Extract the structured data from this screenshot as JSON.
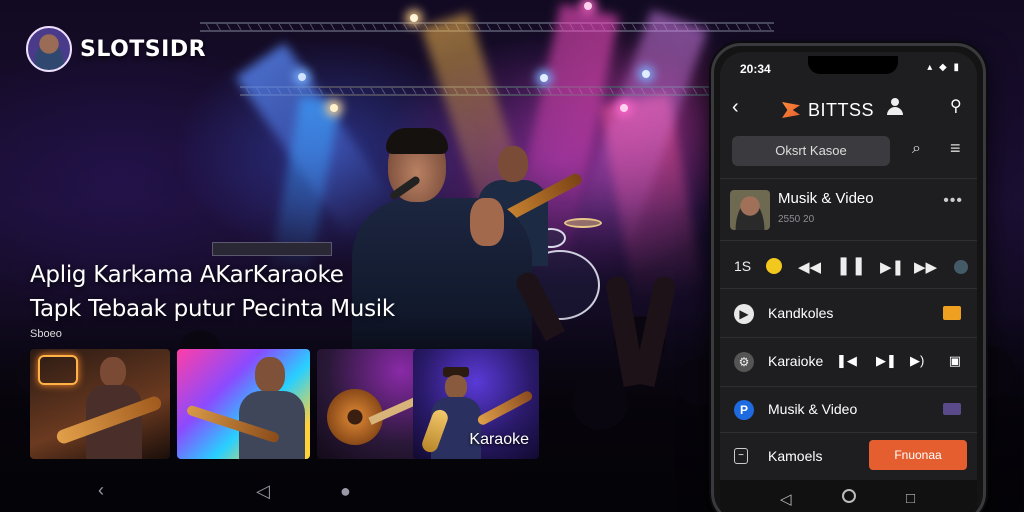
{
  "brand": {
    "name": "SLOTSIDR"
  },
  "headline": {
    "line1": "Aplig Karkama AKarKaraoke",
    "line2": "Tapk Tebaak putur Pecinta Musik",
    "tagline": "Sboeo"
  },
  "thumbnails": [
    {
      "label": ""
    },
    {
      "label": ""
    },
    {
      "label": ""
    },
    {
      "label": "Karaoke"
    }
  ],
  "phone": {
    "time": "20:34",
    "app_title": "BITTSS",
    "search_placeholder": "Oksrt Kasoe",
    "now_playing": {
      "title": "Musik & Video",
      "subtitle": "2550 20",
      "more": "•••"
    },
    "player": {
      "track_number": "1S"
    },
    "rows": [
      {
        "label": "Kandkoles"
      },
      {
        "label": "Karaioke"
      },
      {
        "label": "Musik & Video"
      },
      {
        "label": "Kamoels"
      }
    ],
    "cta_label": "Fnuonaa"
  },
  "colors": {
    "accent": "#e55e2f",
    "phone_bg": "#1e1e20"
  },
  "icons": [
    "back-icon",
    "user-icon",
    "menu-dots-icon",
    "search-icon",
    "hamburger-icon",
    "pause-icon",
    "prev-icon",
    "next-icon",
    "skip-icon",
    "home-icon",
    "recent-icon"
  ]
}
